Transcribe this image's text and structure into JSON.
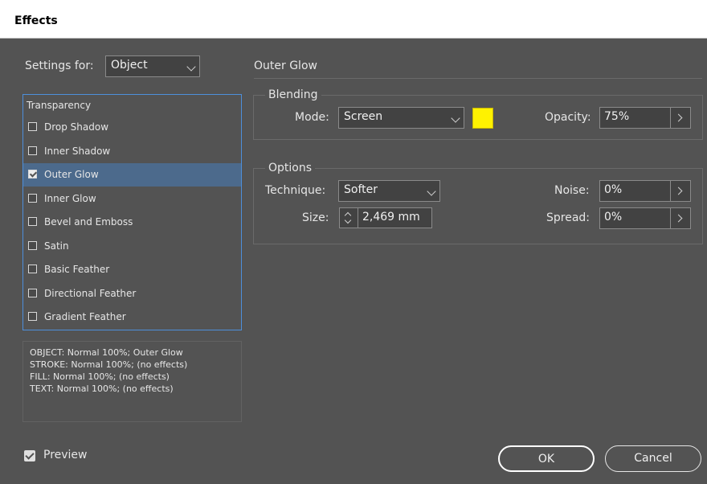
{
  "window": {
    "title": "Effects"
  },
  "settings_for": {
    "label": "Settings for:",
    "value": "Object"
  },
  "effects_list": {
    "header": "Transparency",
    "items": [
      {
        "label": "Drop Shadow",
        "checked": false,
        "selected": false
      },
      {
        "label": "Inner Shadow",
        "checked": false,
        "selected": false
      },
      {
        "label": "Outer Glow",
        "checked": true,
        "selected": true
      },
      {
        "label": "Inner Glow",
        "checked": false,
        "selected": false
      },
      {
        "label": "Bevel and Emboss",
        "checked": false,
        "selected": false
      },
      {
        "label": "Satin",
        "checked": false,
        "selected": false
      },
      {
        "label": "Basic Feather",
        "checked": false,
        "selected": false
      },
      {
        "label": "Directional Feather",
        "checked": false,
        "selected": false
      },
      {
        "label": "Gradient Feather",
        "checked": false,
        "selected": false
      }
    ]
  },
  "summary": {
    "lines": [
      "OBJECT: Normal 100%; Outer Glow",
      "STROKE: Normal 100%; (no effects)",
      "FILL: Normal 100%; (no effects)",
      "TEXT: Normal 100%; (no effects)"
    ]
  },
  "panel": {
    "title": "Outer Glow",
    "blending": {
      "title": "Blending",
      "mode_label": "Mode:",
      "mode_value": "Screen",
      "color": "#fff200",
      "opacity_label": "Opacity:",
      "opacity_value": "75%"
    },
    "options": {
      "title": "Options",
      "technique_label": "Technique:",
      "technique_value": "Softer",
      "size_label": "Size:",
      "size_value": "2,469 mm",
      "noise_label": "Noise:",
      "noise_value": "0%",
      "spread_label": "Spread:",
      "spread_value": "0%"
    }
  },
  "footer": {
    "preview_label": "Preview",
    "preview_checked": true,
    "ok_label": "OK",
    "cancel_label": "Cancel"
  }
}
